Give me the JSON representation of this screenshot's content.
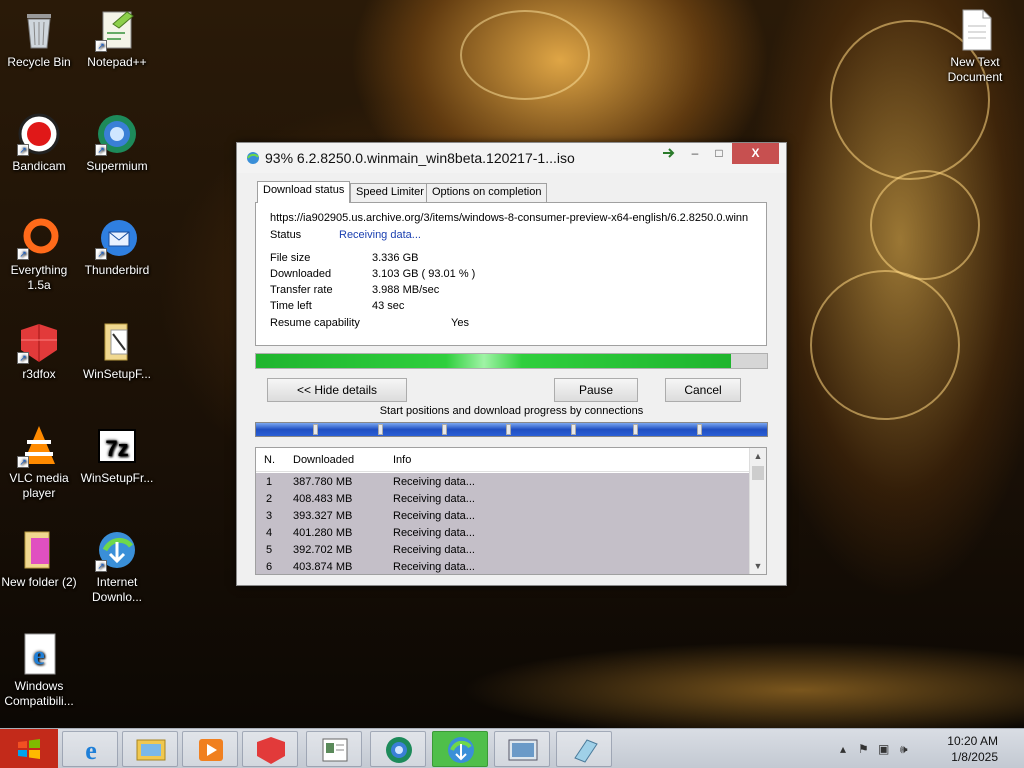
{
  "desktop_icons": [
    {
      "label": "Recycle Bin",
      "icon": "recycle-bin-icon"
    },
    {
      "label": "Notepad++",
      "icon": "notepad-plus-plus-icon"
    },
    {
      "label": "Bandicam",
      "icon": "bandicam-icon"
    },
    {
      "label": "Supermium",
      "icon": "supermium-icon"
    },
    {
      "label": "Everything 1.5a",
      "icon": "everything-icon"
    },
    {
      "label": "Thunderbird",
      "icon": "thunderbird-icon"
    },
    {
      "label": "r3dfox",
      "icon": "r3dfox-icon"
    },
    {
      "label": "WinSetupF...",
      "icon": "folder-icon"
    },
    {
      "label": "VLC media player",
      "icon": "vlc-icon"
    },
    {
      "label": "WinSetupFr...",
      "icon": "7zip-icon"
    },
    {
      "label": "New folder (2)",
      "icon": "folder-icon"
    },
    {
      "label": "Internet Downlo...",
      "icon": "idm-icon"
    },
    {
      "label": "Windows Compatibili...",
      "icon": "ie-icon"
    },
    {
      "label": "New Text Document",
      "icon": "text-document-icon"
    }
  ],
  "window": {
    "title": "93% 6.2.8250.0.winmain_win8beta.120217-1...iso",
    "controls": {
      "arrow": "arrow-icon",
      "minimize": "–",
      "maximize": "□",
      "close": "X"
    },
    "tabs": [
      "Download status",
      "Speed Limiter",
      "Options on completion"
    ],
    "active_tab": "Download status",
    "url": "https://ia902905.us.archive.org/3/items/windows-8-consumer-preview-x64-english/6.2.8250.0.winn",
    "status_label": "Status",
    "status_value": "Receiving data...",
    "fields": [
      {
        "label": "File size",
        "value": "3.336  GB"
      },
      {
        "label": "Downloaded",
        "value": "3.103  GB  ( 93.01 % )"
      },
      {
        "label": "Transfer rate",
        "value": "3.988  MB/sec"
      },
      {
        "label": "Time left",
        "value": "43 sec"
      },
      {
        "label": "Resume capability",
        "value": "Yes"
      }
    ],
    "progress_fraction": 0.9301,
    "buttons": {
      "hide_details": "<< Hide details",
      "pause": "Pause",
      "cancel": "Cancel"
    },
    "connections_caption": "Start positions and download progress by connections",
    "connection_table": {
      "headers": [
        "N.",
        "Downloaded",
        "Info"
      ],
      "rows": [
        {
          "n": "1",
          "downloaded": "387.780  MB",
          "info": "Receiving data..."
        },
        {
          "n": "2",
          "downloaded": "408.483  MB",
          "info": "Receiving data..."
        },
        {
          "n": "3",
          "downloaded": "393.327  MB",
          "info": "Receiving data..."
        },
        {
          "n": "4",
          "downloaded": "401.280  MB",
          "info": "Receiving data..."
        },
        {
          "n": "5",
          "downloaded": "392.702  MB",
          "info": "Receiving data..."
        },
        {
          "n": "6",
          "downloaded": "403.874  MB",
          "info": "Receiving data..."
        }
      ]
    }
  },
  "taskbar": {
    "items": [
      {
        "icon": "internet-explorer-icon"
      },
      {
        "icon": "file-explorer-icon"
      },
      {
        "icon": "media-player-icon"
      },
      {
        "icon": "r3dfox-icon"
      },
      {
        "icon": "notepad-icon"
      },
      {
        "icon": "supermium-icon"
      },
      {
        "icon": "idm-icon"
      },
      {
        "icon": "screenshot-icon"
      },
      {
        "icon": "eraser-icon"
      }
    ],
    "time": "10:20 AM",
    "date": "1/8/2025"
  },
  "colors": {
    "status_blue": "#1a3fb0",
    "progress_green": "#2fcf3d",
    "close_red": "#c75050",
    "row_selected": "#c4bfc8"
  }
}
